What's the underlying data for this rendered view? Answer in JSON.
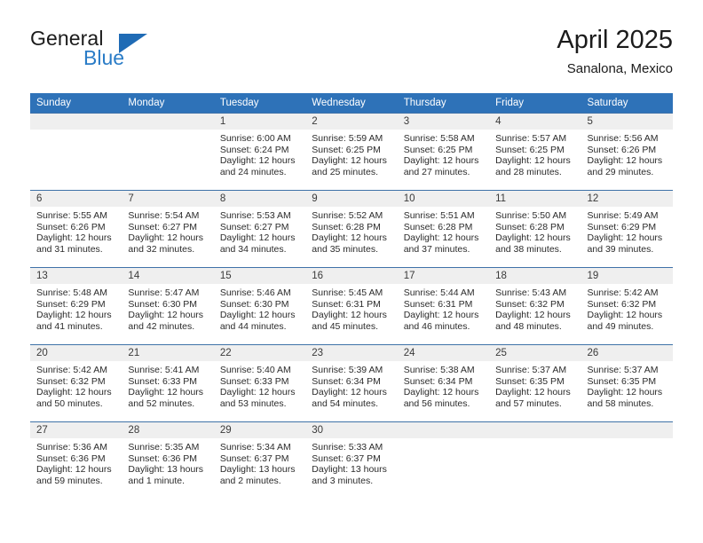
{
  "brand": {
    "name_part1": "General",
    "name_part2": "Blue",
    "triangle_color": "#1f6bb5"
  },
  "header": {
    "title": "April 2025",
    "subtitle": "Sanalona, Mexico"
  },
  "theme": {
    "header_blue": "#2e72b8",
    "row_separator": "#3f72a8",
    "daynum_band": "#efefef"
  },
  "weekday_headers": [
    "Sunday",
    "Monday",
    "Tuesday",
    "Wednesday",
    "Thursday",
    "Friday",
    "Saturday"
  ],
  "weeks": [
    [
      {
        "day": "",
        "sunrise": "",
        "sunset": "",
        "daylight": "",
        "empty": true
      },
      {
        "day": "",
        "sunrise": "",
        "sunset": "",
        "daylight": "",
        "empty": true
      },
      {
        "day": "1",
        "sunrise": "Sunrise: 6:00 AM",
        "sunset": "Sunset: 6:24 PM",
        "daylight": "Daylight: 12 hours and 24 minutes."
      },
      {
        "day": "2",
        "sunrise": "Sunrise: 5:59 AM",
        "sunset": "Sunset: 6:25 PM",
        "daylight": "Daylight: 12 hours and 25 minutes."
      },
      {
        "day": "3",
        "sunrise": "Sunrise: 5:58 AM",
        "sunset": "Sunset: 6:25 PM",
        "daylight": "Daylight: 12 hours and 27 minutes."
      },
      {
        "day": "4",
        "sunrise": "Sunrise: 5:57 AM",
        "sunset": "Sunset: 6:25 PM",
        "daylight": "Daylight: 12 hours and 28 minutes."
      },
      {
        "day": "5",
        "sunrise": "Sunrise: 5:56 AM",
        "sunset": "Sunset: 6:26 PM",
        "daylight": "Daylight: 12 hours and 29 minutes."
      }
    ],
    [
      {
        "day": "6",
        "sunrise": "Sunrise: 5:55 AM",
        "sunset": "Sunset: 6:26 PM",
        "daylight": "Daylight: 12 hours and 31 minutes."
      },
      {
        "day": "7",
        "sunrise": "Sunrise: 5:54 AM",
        "sunset": "Sunset: 6:27 PM",
        "daylight": "Daylight: 12 hours and 32 minutes."
      },
      {
        "day": "8",
        "sunrise": "Sunrise: 5:53 AM",
        "sunset": "Sunset: 6:27 PM",
        "daylight": "Daylight: 12 hours and 34 minutes."
      },
      {
        "day": "9",
        "sunrise": "Sunrise: 5:52 AM",
        "sunset": "Sunset: 6:28 PM",
        "daylight": "Daylight: 12 hours and 35 minutes."
      },
      {
        "day": "10",
        "sunrise": "Sunrise: 5:51 AM",
        "sunset": "Sunset: 6:28 PM",
        "daylight": "Daylight: 12 hours and 37 minutes."
      },
      {
        "day": "11",
        "sunrise": "Sunrise: 5:50 AM",
        "sunset": "Sunset: 6:28 PM",
        "daylight": "Daylight: 12 hours and 38 minutes."
      },
      {
        "day": "12",
        "sunrise": "Sunrise: 5:49 AM",
        "sunset": "Sunset: 6:29 PM",
        "daylight": "Daylight: 12 hours and 39 minutes."
      }
    ],
    [
      {
        "day": "13",
        "sunrise": "Sunrise: 5:48 AM",
        "sunset": "Sunset: 6:29 PM",
        "daylight": "Daylight: 12 hours and 41 minutes."
      },
      {
        "day": "14",
        "sunrise": "Sunrise: 5:47 AM",
        "sunset": "Sunset: 6:30 PM",
        "daylight": "Daylight: 12 hours and 42 minutes."
      },
      {
        "day": "15",
        "sunrise": "Sunrise: 5:46 AM",
        "sunset": "Sunset: 6:30 PM",
        "daylight": "Daylight: 12 hours and 44 minutes."
      },
      {
        "day": "16",
        "sunrise": "Sunrise: 5:45 AM",
        "sunset": "Sunset: 6:31 PM",
        "daylight": "Daylight: 12 hours and 45 minutes."
      },
      {
        "day": "17",
        "sunrise": "Sunrise: 5:44 AM",
        "sunset": "Sunset: 6:31 PM",
        "daylight": "Daylight: 12 hours and 46 minutes."
      },
      {
        "day": "18",
        "sunrise": "Sunrise: 5:43 AM",
        "sunset": "Sunset: 6:32 PM",
        "daylight": "Daylight: 12 hours and 48 minutes."
      },
      {
        "day": "19",
        "sunrise": "Sunrise: 5:42 AM",
        "sunset": "Sunset: 6:32 PM",
        "daylight": "Daylight: 12 hours and 49 minutes."
      }
    ],
    [
      {
        "day": "20",
        "sunrise": "Sunrise: 5:42 AM",
        "sunset": "Sunset: 6:32 PM",
        "daylight": "Daylight: 12 hours and 50 minutes."
      },
      {
        "day": "21",
        "sunrise": "Sunrise: 5:41 AM",
        "sunset": "Sunset: 6:33 PM",
        "daylight": "Daylight: 12 hours and 52 minutes."
      },
      {
        "day": "22",
        "sunrise": "Sunrise: 5:40 AM",
        "sunset": "Sunset: 6:33 PM",
        "daylight": "Daylight: 12 hours and 53 minutes."
      },
      {
        "day": "23",
        "sunrise": "Sunrise: 5:39 AM",
        "sunset": "Sunset: 6:34 PM",
        "daylight": "Daylight: 12 hours and 54 minutes."
      },
      {
        "day": "24",
        "sunrise": "Sunrise: 5:38 AM",
        "sunset": "Sunset: 6:34 PM",
        "daylight": "Daylight: 12 hours and 56 minutes."
      },
      {
        "day": "25",
        "sunrise": "Sunrise: 5:37 AM",
        "sunset": "Sunset: 6:35 PM",
        "daylight": "Daylight: 12 hours and 57 minutes."
      },
      {
        "day": "26",
        "sunrise": "Sunrise: 5:37 AM",
        "sunset": "Sunset: 6:35 PM",
        "daylight": "Daylight: 12 hours and 58 minutes."
      }
    ],
    [
      {
        "day": "27",
        "sunrise": "Sunrise: 5:36 AM",
        "sunset": "Sunset: 6:36 PM",
        "daylight": "Daylight: 12 hours and 59 minutes."
      },
      {
        "day": "28",
        "sunrise": "Sunrise: 5:35 AM",
        "sunset": "Sunset: 6:36 PM",
        "daylight": "Daylight: 13 hours and 1 minute."
      },
      {
        "day": "29",
        "sunrise": "Sunrise: 5:34 AM",
        "sunset": "Sunset: 6:37 PM",
        "daylight": "Daylight: 13 hours and 2 minutes."
      },
      {
        "day": "30",
        "sunrise": "Sunrise: 5:33 AM",
        "sunset": "Sunset: 6:37 PM",
        "daylight": "Daylight: 13 hours and 3 minutes."
      },
      {
        "day": "",
        "sunrise": "",
        "sunset": "",
        "daylight": "",
        "empty": true
      },
      {
        "day": "",
        "sunrise": "",
        "sunset": "",
        "daylight": "",
        "empty": true
      },
      {
        "day": "",
        "sunrise": "",
        "sunset": "",
        "daylight": "",
        "empty": true
      }
    ]
  ]
}
